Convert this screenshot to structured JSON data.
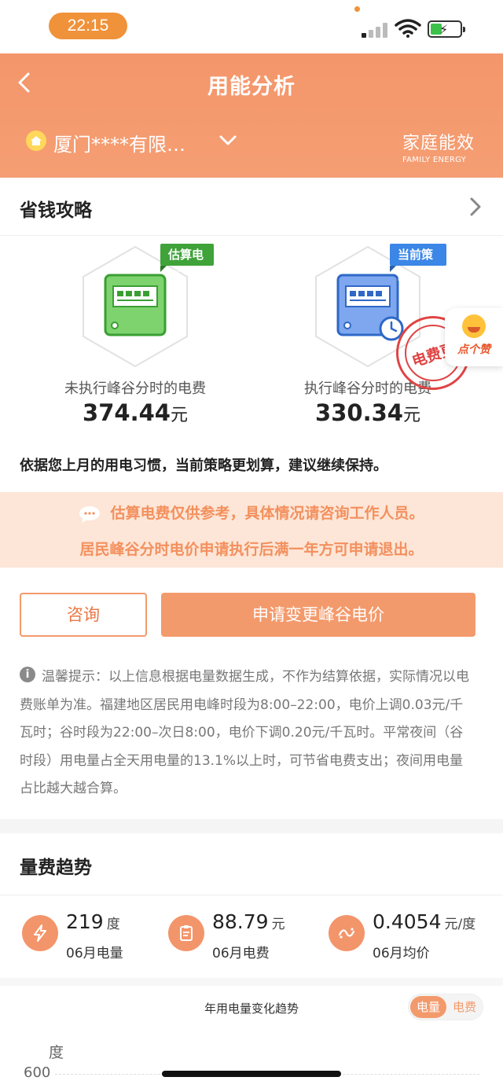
{
  "status_bar": {
    "time": "22:15"
  },
  "header": {
    "title": "用能分析",
    "account": "厦门****有限…",
    "brand_cn": "家庭能效",
    "brand_en": "FAMILY ENERGY"
  },
  "strategy": {
    "title": "省钱攻略",
    "left": {
      "tag": "估算电费",
      "label": "未执行峰谷分时的电费",
      "value": "374.44",
      "unit": "元"
    },
    "right": {
      "tag": "当前策略",
      "label": "执行峰谷分时的电费",
      "value": "330.34",
      "unit": "元"
    },
    "stamp_text": "电费更",
    "like_label": "点个赞",
    "advice": "依据您上月的用电习惯，当前策略更划算，建议继续保持。"
  },
  "notice": {
    "line1": "估算电费仅供参考，具体情况请咨询工作人员。",
    "line2": "居民峰谷分时电价申请执行后满一年方可申请退出。"
  },
  "buttons": {
    "consult": "咨询",
    "apply": "申请变更峰谷电价"
  },
  "tip": {
    "text": "温馨提示：以上信息根据电量数据生成，不作为结算依据，实际情况以电费账单为准。福建地区居民用电峰时段为8:00–22:00，电价上调0.03元/千瓦时；谷时段为22:00–次日8:00，电价下调0.20元/千瓦时。平常夜间（谷时段）用电量占全天用电量的13.1%以上时，可节省电费支出；夜间用电量占比越大越合算。"
  },
  "trend": {
    "title": "量费趋势",
    "stats": [
      {
        "value": "219",
        "unit": "度",
        "caption": "06月电量",
        "icon": "lightning-icon"
      },
      {
        "value": "88.79",
        "unit": "元",
        "caption": "06月电费",
        "icon": "bill-icon"
      },
      {
        "value": "0.4054",
        "unit": "元/度",
        "caption": "06月均价",
        "icon": "price-icon"
      }
    ],
    "chart_title": "年用电量变化趋势",
    "toggle_on": "电量",
    "toggle_off": "电费",
    "axis_unit": "度",
    "axis_tick": "600"
  },
  "colors": {
    "accent": "#f39a6c",
    "green_tag": "#3fa33a",
    "blue_tag": "#3b86e6",
    "stamp": "#e04444"
  }
}
